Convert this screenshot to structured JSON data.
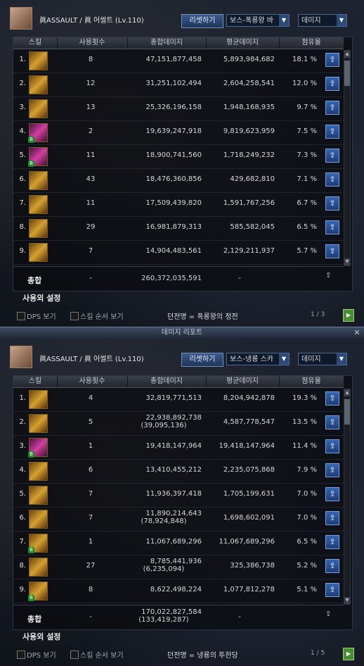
{
  "reports": [
    {
      "character": "眞ASSAULT / 眞 어썰트 (Lv.110)",
      "reset_button": "리셋하기",
      "boss_select": "보스-폭룡왕 바",
      "metric_select": "데미지",
      "columns": [
        "스킬",
        "사용횟수",
        "총합데미지",
        "평균데미지",
        "점유율"
      ],
      "rows": [
        {
          "rank": "1.",
          "count": "8",
          "total": "47,151,877,458",
          "total_sub": "",
          "avg": "5,893,984,682",
          "rate": "18.1 %",
          "icon": "gold",
          "badge": ""
        },
        {
          "rank": "2.",
          "count": "12",
          "total": "31,251,102,494",
          "total_sub": "",
          "avg": "2,604,258,541",
          "rate": "12.0 %",
          "icon": "gold",
          "badge": ""
        },
        {
          "rank": "3.",
          "count": "13",
          "total": "25,326,196,158",
          "total_sub": "",
          "avg": "1,948,168,935",
          "rate": "9.7 %",
          "icon": "gold",
          "badge": ""
        },
        {
          "rank": "4.",
          "count": "2",
          "total": "19,639,247,918",
          "total_sub": "",
          "avg": "9,819,623,959",
          "rate": "7.5 %",
          "icon": "purple",
          "badge": "B"
        },
        {
          "rank": "5.",
          "count": "11",
          "total": "18,900,741,560",
          "total_sub": "",
          "avg": "1,718,249,232",
          "rate": "7.3 %",
          "icon": "purple",
          "badge": "B"
        },
        {
          "rank": "6.",
          "count": "43",
          "total": "18,476,360,856",
          "total_sub": "",
          "avg": "429,682,810",
          "rate": "7.1 %",
          "icon": "gold",
          "badge": ""
        },
        {
          "rank": "7.",
          "count": "11",
          "total": "17,509,439,820",
          "total_sub": "",
          "avg": "1,591,767,256",
          "rate": "6.7 %",
          "icon": "gold",
          "badge": ""
        },
        {
          "rank": "8.",
          "count": "29",
          "total": "16,981,879,313",
          "total_sub": "",
          "avg": "585,582,045",
          "rate": "6.5 %",
          "icon": "gold",
          "badge": ""
        },
        {
          "rank": "9.",
          "count": "7",
          "total": "14,904,483,561",
          "total_sub": "",
          "avg": "2,129,211,937",
          "rate": "5.7 %",
          "icon": "gold",
          "badge": ""
        }
      ],
      "summary": {
        "label": "총합",
        "count": "-",
        "total": "260,372,035,591",
        "total_sub": "",
        "avg": "-"
      },
      "settings_label": "사용외 설정",
      "dps_label": "DPS 보기",
      "skill_order_label": "스킬 순서 보기",
      "dungeon": "던전명 = 폭룡왕의 정전",
      "page": "1 / 3"
    },
    {
      "character": "眞ASSAULT / 眞 어썰트 (Lv.110)",
      "reset_button": "리셋하기",
      "boss_select": "보스-냉룡 스카",
      "metric_select": "데미지",
      "columns": [
        "스킬",
        "사용횟수",
        "총합데미지",
        "평균데미지",
        "점유율"
      ],
      "rows": [
        {
          "rank": "1.",
          "count": "4",
          "total": "32,819,771,513",
          "total_sub": "",
          "avg": "8,204,942,878",
          "rate": "19.3 %",
          "icon": "gold",
          "badge": ""
        },
        {
          "rank": "2.",
          "count": "5",
          "total": "22,938,892,738",
          "total_sub": "(39,095,136)",
          "avg": "4,587,778,547",
          "rate": "13.5 %",
          "icon": "gold",
          "badge": ""
        },
        {
          "rank": "3.",
          "count": "1",
          "total": "19,418,147,964",
          "total_sub": "",
          "avg": "19,418,147,964",
          "rate": "11.4 %",
          "icon": "purple",
          "badge": "B"
        },
        {
          "rank": "4.",
          "count": "6",
          "total": "13,410,455,212",
          "total_sub": "",
          "avg": "2,235,075,868",
          "rate": "7.9 %",
          "icon": "gold",
          "badge": ""
        },
        {
          "rank": "5.",
          "count": "7",
          "total": "11,936,397,418",
          "total_sub": "",
          "avg": "1,705,199,631",
          "rate": "7.0 %",
          "icon": "gold",
          "badge": ""
        },
        {
          "rank": "6.",
          "count": "7",
          "total": "11,890,214,643",
          "total_sub": "(78,924,848)",
          "avg": "1,698,602,091",
          "rate": "7.0 %",
          "icon": "gold",
          "badge": ""
        },
        {
          "rank": "7.",
          "count": "1",
          "total": "11,067,689,296",
          "total_sub": "",
          "avg": "11,067,689,296",
          "rate": "6.5 %",
          "icon": "gold",
          "badge": "B"
        },
        {
          "rank": "8.",
          "count": "27",
          "total": "8,785,441,936",
          "total_sub": "(6,235,094)",
          "avg": "325,386,738",
          "rate": "5.2 %",
          "icon": "gold",
          "badge": ""
        },
        {
          "rank": "9.",
          "count": "8",
          "total": "8,622,498,224",
          "total_sub": "",
          "avg": "1,077,812,278",
          "rate": "5.1 %",
          "icon": "gold",
          "badge": "B"
        }
      ],
      "summary": {
        "label": "총합",
        "count": "-",
        "total": "170,022,827,584",
        "total_sub": "(133,419,287)",
        "avg": "-"
      },
      "settings_label": "사용외 설정",
      "dps_label": "DPS 보기",
      "skill_order_label": "스킬 순서 보기",
      "dungeon": "던전명 = 냉룡의 투한당",
      "page": "1 / 5"
    }
  ],
  "window_title": "데미지 리포트",
  "icons": {
    "share": "share-icon",
    "close": "close-icon",
    "next": "next-page-icon"
  }
}
